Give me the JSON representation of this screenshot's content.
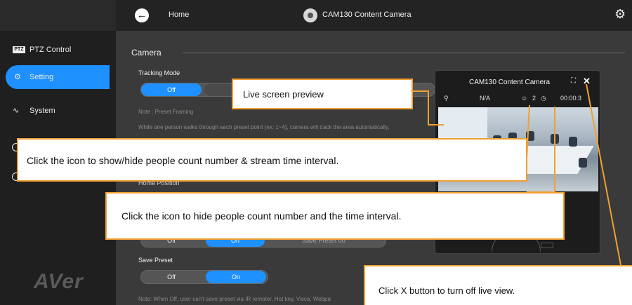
{
  "topbar": {
    "home_label": "Home",
    "camera_title": "CAM130 Content Camera"
  },
  "sidebar": {
    "items": [
      {
        "label": "PTZ Control",
        "icon": "ptz-icon"
      },
      {
        "label": "Setting",
        "icon": "gear-icon",
        "active": true
      },
      {
        "label": "System",
        "icon": "pulse-icon"
      }
    ],
    "logo": "AVer"
  },
  "main": {
    "section_title": "Camera",
    "tracking_mode": {
      "label": "Tracking Mode",
      "options": [
        "Off",
        ""
      ],
      "selected": "Off",
      "note_heading": "Note : Preset Framing",
      "note_text": "While one person walks through each preset point (ex: 1~4), camera will track the area automatically."
    },
    "home_position": {
      "label": "Home Position",
      "options": [
        "Off",
        "On",
        "Save Preset 00"
      ],
      "selected": "On"
    },
    "save_preset": {
      "label": "Save Preset",
      "options": [
        "Off",
        "On"
      ],
      "selected": "On",
      "note": "Note: When Off, user can't save preset via IR remoter, Hot key, Visca, Webpa"
    }
  },
  "preview": {
    "title": "CAM130 Content Camera",
    "na_label": "N/A",
    "people_count": "2",
    "time": "00:00:3"
  },
  "callouts": {
    "live_preview": "Live screen preview",
    "show_hide": "Click the icon to show/hide people count number & stream time interval.",
    "hide": "Click the icon to hide people count number and the time interval.",
    "close": "Click X button to turn off live view."
  },
  "colors": {
    "accent": "#1e90ff",
    "callout_border": "#f0a030",
    "sidebar_bg": "#1f1f1f",
    "main_bg": "#3a3a3a"
  }
}
